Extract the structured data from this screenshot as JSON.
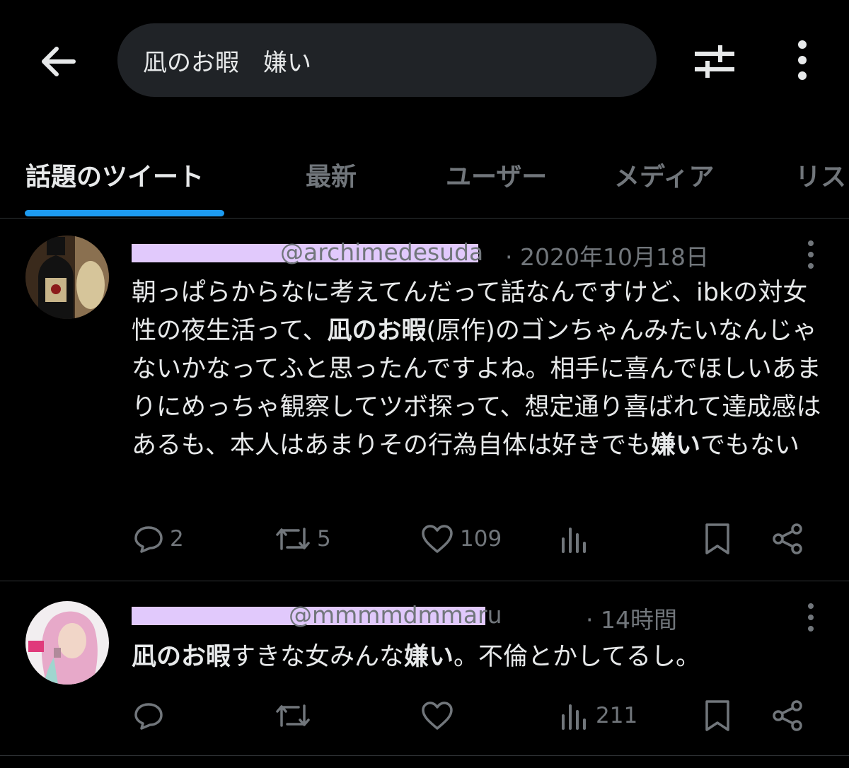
{
  "search": {
    "query": "凪のお暇　嫌い"
  },
  "tabs": [
    {
      "label": "話題のツイート"
    },
    {
      "label": "最新"
    },
    {
      "label": "ユーザー"
    },
    {
      "label": "メディア"
    },
    {
      "label": "リス"
    }
  ],
  "tweets": [
    {
      "handle": "@archimedesuda",
      "date": "· 2020年10月18日",
      "body_parts": [
        {
          "t": "朝っぱらからなに考えてんだって話なんですけど、ibkの対女性の夜生活って、",
          "b": false
        },
        {
          "t": "凪のお暇",
          "b": true
        },
        {
          "t": "(原作)のゴンちゃんみたいなんじゃないかなってふと思ったんですよね。相手に喜んでほしいあまりにめっちゃ観察してツボ探って、想定通り喜ばれて達成感はあるも、本人はあまりその行為自体は好きでも",
          "b": false
        },
        {
          "t": "嫌い",
          "b": true
        },
        {
          "t": "でもない",
          "b": false
        }
      ],
      "replies": "2",
      "retweets": "5",
      "likes": "109",
      "views": ""
    },
    {
      "handle": "@mmmmdmmaru",
      "date": "· 14時間",
      "body_parts": [
        {
          "t": "凪のお暇",
          "b": true
        },
        {
          "t": "すきな女みんな",
          "b": false
        },
        {
          "t": "嫌い",
          "b": true
        },
        {
          "t": "。不倫とかしてるし。",
          "b": false
        }
      ],
      "replies": "",
      "retweets": "",
      "likes": "",
      "views": "211"
    }
  ],
  "colors": {
    "accent": "#1d9bf0",
    "redaction": "#e1c9fc",
    "muted": "#71767b"
  },
  "icons": [
    "back-arrow-icon",
    "filter-sliders-icon",
    "more-vertical-icon",
    "reply-icon",
    "retweet-icon",
    "like-icon",
    "views-icon",
    "bookmark-icon",
    "share-icon"
  ]
}
